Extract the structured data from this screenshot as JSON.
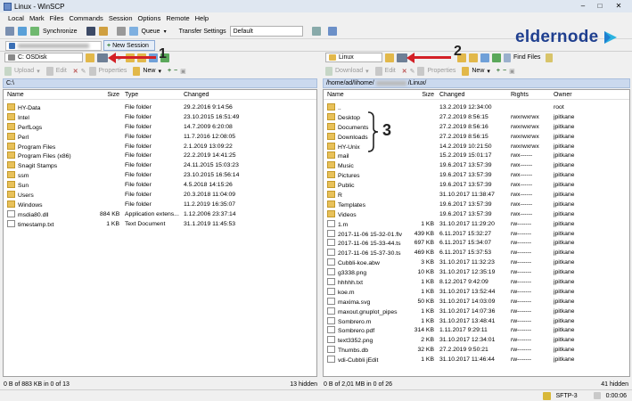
{
  "window": {
    "title": "Linux - WinSCP",
    "minimize": "–",
    "maximize": "□",
    "close": "✕"
  },
  "menu": [
    "Local",
    "Mark",
    "Files",
    "Commands",
    "Session",
    "Options",
    "Remote",
    "Help"
  ],
  "toolbar": {
    "synchronize": "Synchronize",
    "queue": "Queue",
    "transfer_label": "Transfer Settings",
    "transfer_value": "Default"
  },
  "session": {
    "new_session": "New Session"
  },
  "watermark": "eldernode",
  "annotations": {
    "one": "1",
    "two": "2",
    "three": "3"
  },
  "left": {
    "drive": "C: OSDisk",
    "actions": {
      "upload": "Upload",
      "edit": "Edit",
      "properties": "Properties",
      "new": "New"
    },
    "path": "C:\\",
    "columns": {
      "name": "Name",
      "size": "Size",
      "type": "Type",
      "changed": "Changed"
    },
    "rows": [
      {
        "name": "HY-Data",
        "size": "",
        "type": "File folder",
        "changed": "29.2.2016 9:14:56",
        "kind": "folder"
      },
      {
        "name": "Intel",
        "size": "",
        "type": "File folder",
        "changed": "23.10.2015 16:51:49",
        "kind": "folder"
      },
      {
        "name": "PerfLogs",
        "size": "",
        "type": "File folder",
        "changed": "14.7.2009 6:20:08",
        "kind": "folder"
      },
      {
        "name": "Perl",
        "size": "",
        "type": "File folder",
        "changed": "11.7.2016 12:08:05",
        "kind": "folder"
      },
      {
        "name": "Program Files",
        "size": "",
        "type": "File folder",
        "changed": "2.1.2019 13:09:22",
        "kind": "folder"
      },
      {
        "name": "Program Files (x86)",
        "size": "",
        "type": "File folder",
        "changed": "22.2.2019 14:41:25",
        "kind": "folder"
      },
      {
        "name": "Snagit Stamps",
        "size": "",
        "type": "File folder",
        "changed": "24.11.2015 15:03:23",
        "kind": "folder"
      },
      {
        "name": "ssm",
        "size": "",
        "type": "File folder",
        "changed": "23.10.2015 16:56:14",
        "kind": "folder"
      },
      {
        "name": "Sun",
        "size": "",
        "type": "File folder",
        "changed": "4.5.2018 14:15:26",
        "kind": "folder"
      },
      {
        "name": "Users",
        "size": "",
        "type": "File folder",
        "changed": "20.3.2018 11:04:09",
        "kind": "folder"
      },
      {
        "name": "Windows",
        "size": "",
        "type": "File folder",
        "changed": "11.2.2019 16:35:07",
        "kind": "folder"
      },
      {
        "name": "msdia80.dll",
        "size": "884 KB",
        "type": "Application extens...",
        "changed": "1.12.2006 23:37:14",
        "kind": "file"
      },
      {
        "name": "timestamp.txt",
        "size": "1 KB",
        "type": "Text Document",
        "changed": "31.1.2019 11:45:53",
        "kind": "file"
      }
    ],
    "status": "0 B of 883 KB in 0 of 13",
    "hidden": "13 hidden"
  },
  "right": {
    "drive": "Linux",
    "find": "Find Files",
    "actions": {
      "download": "Download",
      "edit": "Edit",
      "properties": "Properties",
      "new": "New"
    },
    "path_prefix": "/home/ad/lihome/",
    "path_suffix": "/Linux/",
    "columns": {
      "name": "Name",
      "size": "Size",
      "changed": "Changed",
      "rights": "Rights",
      "owner": "Owner"
    },
    "rows": [
      {
        "name": "..",
        "size": "",
        "changed": "13.2.2019 12:34:00",
        "rights": "",
        "owner": "root",
        "kind": "up"
      },
      {
        "name": "Desktop",
        "size": "",
        "changed": "27.2.2019 8:56:15",
        "rights": "rwxrwxrwx",
        "owner": "jpitkane",
        "kind": "folder"
      },
      {
        "name": "Documents",
        "size": "",
        "changed": "27.2.2019 8:56:16",
        "rights": "rwxrwxrwx",
        "owner": "jpitkane",
        "kind": "folder"
      },
      {
        "name": "Downloads",
        "size": "",
        "changed": "27.2.2019 8:56:15",
        "rights": "rwxrwxrwx",
        "owner": "jpitkane",
        "kind": "folder"
      },
      {
        "name": "HY-Unix",
        "size": "",
        "changed": "14.2.2019 10:21:50",
        "rights": "rwxrwxrwx",
        "owner": "jpitkane",
        "kind": "folder"
      },
      {
        "name": "mail",
        "size": "",
        "changed": "15.2.2019 15:01:17",
        "rights": "rwx------",
        "owner": "jpitkane",
        "kind": "folder"
      },
      {
        "name": "Music",
        "size": "",
        "changed": "19.6.2017 13:57:39",
        "rights": "rwx------",
        "owner": "jpitkane",
        "kind": "folder"
      },
      {
        "name": "Pictures",
        "size": "",
        "changed": "19.6.2017 13:57:39",
        "rights": "rwx------",
        "owner": "jpitkane",
        "kind": "folder"
      },
      {
        "name": "Public",
        "size": "",
        "changed": "19.6.2017 13:57:39",
        "rights": "rwx------",
        "owner": "jpitkane",
        "kind": "folder"
      },
      {
        "name": "R",
        "size": "",
        "changed": "31.10.2017 11:38:47",
        "rights": "rwx------",
        "owner": "jpitkane",
        "kind": "folder"
      },
      {
        "name": "Templates",
        "size": "",
        "changed": "19.6.2017 13:57:39",
        "rights": "rwx------",
        "owner": "jpitkane",
        "kind": "folder"
      },
      {
        "name": "Videos",
        "size": "",
        "changed": "19.6.2017 13:57:39",
        "rights": "rwx------",
        "owner": "jpitkane",
        "kind": "folder"
      },
      {
        "name": "1.m",
        "size": "1 KB",
        "changed": "31.10.2017 11:29:20",
        "rights": "rw-------",
        "owner": "jpitkane",
        "kind": "file"
      },
      {
        "name": "2017-11-06 15-32-01.flv",
        "size": "439 KB",
        "changed": "6.11.2017 15:32:27",
        "rights": "rw-------",
        "owner": "jpitkane",
        "kind": "file"
      },
      {
        "name": "2017-11-06 15-33-44.ts",
        "size": "697 KB",
        "changed": "6.11.2017 15:34:07",
        "rights": "rw-------",
        "owner": "jpitkane",
        "kind": "file"
      },
      {
        "name": "2017-11-06 15-37-30.ts",
        "size": "469 KB",
        "changed": "6.11.2017 15:37:53",
        "rights": "rw-------",
        "owner": "jpitkane",
        "kind": "file"
      },
      {
        "name": "Cubbli-koe.abw",
        "size": "3 KB",
        "changed": "31.10.2017 11:32:23",
        "rights": "rw-------",
        "owner": "jpitkane",
        "kind": "file"
      },
      {
        "name": "g3338.png",
        "size": "10 KB",
        "changed": "31.10.2017 12:35:19",
        "rights": "rw-------",
        "owner": "jpitkane",
        "kind": "file"
      },
      {
        "name": "hhhhh.txt",
        "size": "1 KB",
        "changed": "8.12.2017 9:42:09",
        "rights": "rw-------",
        "owner": "jpitkane",
        "kind": "file"
      },
      {
        "name": "koe.m",
        "size": "1 KB",
        "changed": "31.10.2017 13:52:44",
        "rights": "rw-------",
        "owner": "jpitkane",
        "kind": "file"
      },
      {
        "name": "maxima.svg",
        "size": "50 KB",
        "changed": "31.10.2017 14:03:09",
        "rights": "rw-------",
        "owner": "jpitkane",
        "kind": "file"
      },
      {
        "name": "maxout.gnuplot_pipes",
        "size": "1 KB",
        "changed": "31.10.2017 14:07:36",
        "rights": "rw-------",
        "owner": "jpitkane",
        "kind": "file"
      },
      {
        "name": "Sombrero.m",
        "size": "1 KB",
        "changed": "31.10.2017 13:48:41",
        "rights": "rw-------",
        "owner": "jpitkane",
        "kind": "file"
      },
      {
        "name": "Sombrero.pdf",
        "size": "314 KB",
        "changed": "1.11.2017 9:29:11",
        "rights": "rw-------",
        "owner": "jpitkane",
        "kind": "file"
      },
      {
        "name": "text3352.png",
        "size": "2 KB",
        "changed": "31.10.2017 12:34:01",
        "rights": "rw-------",
        "owner": "jpitkane",
        "kind": "file"
      },
      {
        "name": "Thumbs.db",
        "size": "32 KB",
        "changed": "27.2.2019 9:50:21",
        "rights": "rw-------",
        "owner": "jpitkane",
        "kind": "file"
      },
      {
        "name": "vdi-Cubbli jEdit",
        "size": "1 KB",
        "changed": "31.10.2017 11:46:44",
        "rights": "rw-------",
        "owner": "jpitkane",
        "kind": "file"
      }
    ],
    "status": "0 B of 2,01 MB in 0 of 26",
    "hidden": "41 hidden"
  },
  "bottom": {
    "protocol": "SFTP-3",
    "timer": "0:00:06"
  }
}
